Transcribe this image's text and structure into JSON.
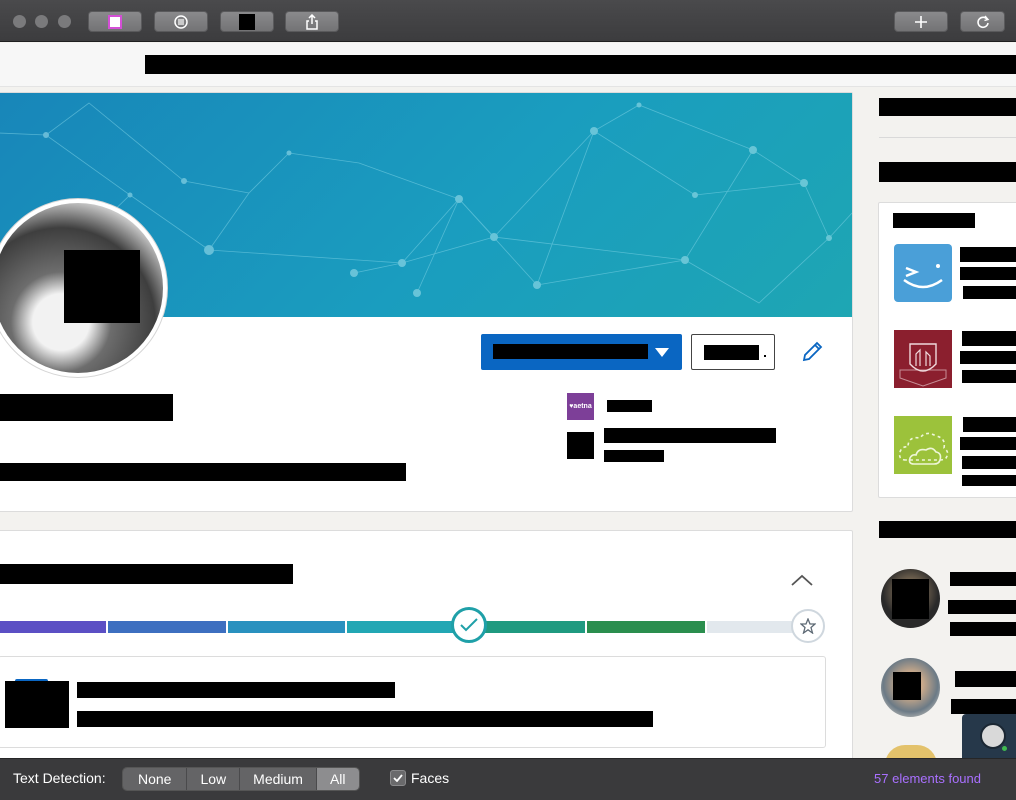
{
  "titlebar": {
    "buttons": [
      "layout-toggle",
      "menu",
      "color-swatch",
      "share",
      "new-tab",
      "reload"
    ]
  },
  "profile": {
    "company_logo_text": "♥aetna"
  },
  "status_bar": {
    "label": "Text Detection:",
    "levels": [
      "None",
      "Low",
      "Medium",
      "All"
    ],
    "selected_level": "All",
    "faces_label": "Faces",
    "faces_checked": true,
    "elements_found": "57 elements found"
  },
  "colors": {
    "accent_purple": "#a970ff",
    "linkedin_blue": "#0a66c2",
    "aetna_purple": "#7d3f98"
  }
}
